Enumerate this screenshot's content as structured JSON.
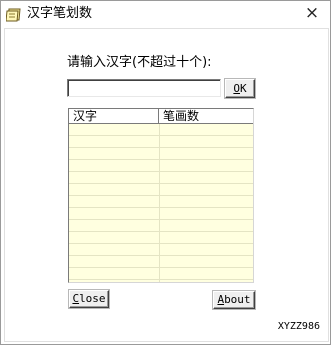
{
  "window": {
    "title": "汉字笔划数",
    "close_glyph": "×"
  },
  "form": {
    "prompt": "请输入汉字(不超过十个):",
    "input_value": "",
    "input_placeholder": "",
    "ok_label": "OK"
  },
  "table": {
    "columns": [
      "汉字",
      "笔画数"
    ],
    "rows": []
  },
  "footer": {
    "close_label": "Close",
    "about_label": "About",
    "watermark": "XYZZ986"
  }
}
